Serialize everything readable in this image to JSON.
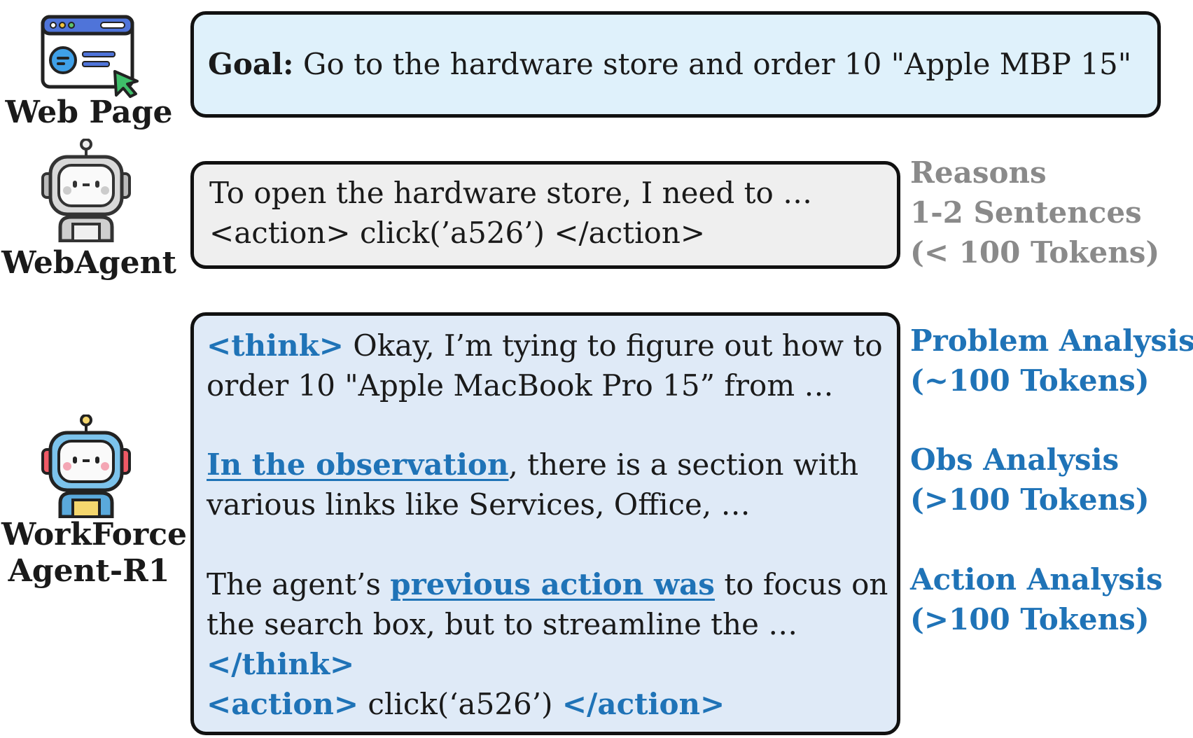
{
  "webpage": {
    "label": "Web Page"
  },
  "webagent": {
    "label": "WebAgent"
  },
  "r1agent": {
    "label_line1": "WorkForce",
    "label_line2": "Agent-R1"
  },
  "goal": {
    "prefix": "Goal:",
    "text": " Go to the hardware store and order 10 \"Apple MBP 15\""
  },
  "webagent_output": {
    "line1": "To open the hardware store, I need to …",
    "line2": "<action> click(’a526’) </action>"
  },
  "webagent_notes": {
    "line1": "Reasons",
    "line2": "1-2 Sentences",
    "line3": "(< 100 Tokens)"
  },
  "r1_output": {
    "think_open": "<think>",
    "p1_line1": " Okay, I’m tying to figure out how to",
    "p1_line2": "order 10 \"Apple MacBook Pro 15” from …",
    "p2_highlight": "In the observation",
    "p2_line1_rest": ", there is a section with",
    "p2_line2": "various links like Services, Office, …",
    "p3_pre": "The agent’s ",
    "p3_highlight": "previous action was",
    "p3_line1_rest": " to focus on",
    "p3_line2": "the search box, but to streamline the …",
    "think_close": "</think>",
    "action_open": "<action>",
    "action_body": " click(‘a526’) ",
    "action_close": "</action>"
  },
  "r1_notes": {
    "problem_title": "Problem Analysis",
    "problem_tokens": "(~100 Tokens)",
    "obs_title": "Obs Analysis",
    "obs_tokens": "(>100 Tokens)",
    "action_title": "Action Analysis",
    "action_tokens": "(>100 Tokens)"
  },
  "colors": {
    "accent_blue": "#1f73b7",
    "note_gray": "#8a8a8a",
    "goal_fill": "#dff1fb",
    "agent_fill": "#efefef",
    "r1_fill": "#dfeaf7"
  }
}
